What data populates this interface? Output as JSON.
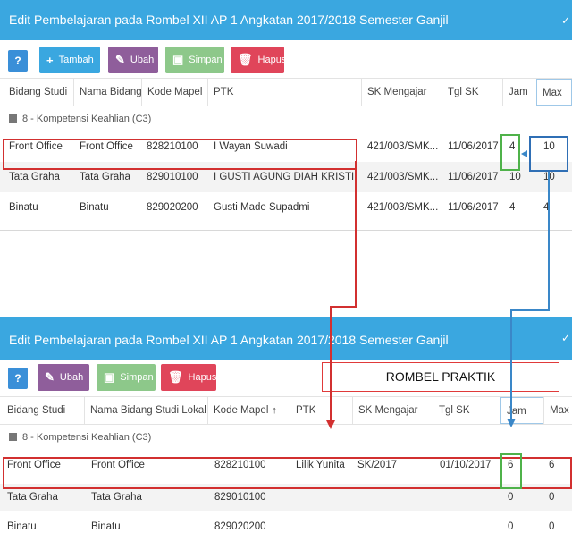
{
  "panel_top": {
    "title": "Edit Pembelajaran pada Rombel XII AP 1 Angkatan 2017/2018 Semester Ganjil",
    "buttons": {
      "help": "?",
      "add": "Tambah",
      "edit": "Ubah",
      "save": "Simpan",
      "delete": "Hapus"
    },
    "columns": [
      "Bidang Studi",
      "Nama Bidang...",
      "Kode Mapel",
      "PTK",
      "SK Mengajar",
      "Tgl SK",
      "Jam",
      "Max"
    ],
    "group_label": "8 - Kompetensi Keahlian (C3)",
    "rows": [
      [
        "Front Office",
        "Front Office",
        "828210100",
        "I Wayan Suwadi",
        "421/003/SMK...",
        "11/06/2017",
        "4",
        "10"
      ],
      [
        "Tata Graha",
        "Tata Graha",
        "829010100",
        "I GUSTI AGUNG DIAH KRISTINA ...",
        "421/003/SMK...",
        "11/06/2017",
        "10",
        "10"
      ],
      [
        "Binatu",
        "Binatu",
        "829020200",
        "Gusti Made Supadmi",
        "421/003/SMK...",
        "11/06/2017",
        "4",
        "4"
      ]
    ]
  },
  "panel_bottom": {
    "title": "Edit Pembelajaran pada Rombel XII AP 1 Angkatan 2017/2018 Semester Ganjil",
    "buttons": {
      "help": "?",
      "edit": "Ubah",
      "save": "Simpan",
      "delete": "Hapus"
    },
    "label_box": "ROMBEL PRAKTIK",
    "columns": [
      "Bidang Studi",
      "Nama Bidang Studi Lokal",
      "Kode Mapel",
      "PTK",
      "SK Mengajar",
      "Tgl SK",
      "Jam",
      "Max"
    ],
    "group_label": "8 - Kompetensi Keahlian (C3)",
    "rows": [
      [
        "Front Office",
        "Front Office",
        "828210100",
        "Lilik Yunita",
        "SK/2017",
        "01/10/2017",
        "6",
        "6"
      ],
      [
        "Tata Graha",
        "Tata Graha",
        "829010100",
        "",
        "",
        "",
        "0",
        "0"
      ],
      [
        "Binatu",
        "Binatu",
        "829020200",
        "",
        "",
        "",
        "0",
        "0"
      ]
    ]
  },
  "colors": {
    "titlebar": "#3aa7e0",
    "highlight_red": "#d23030",
    "highlight_green": "#4fb24a",
    "highlight_blue": "#2f6fb5"
  }
}
